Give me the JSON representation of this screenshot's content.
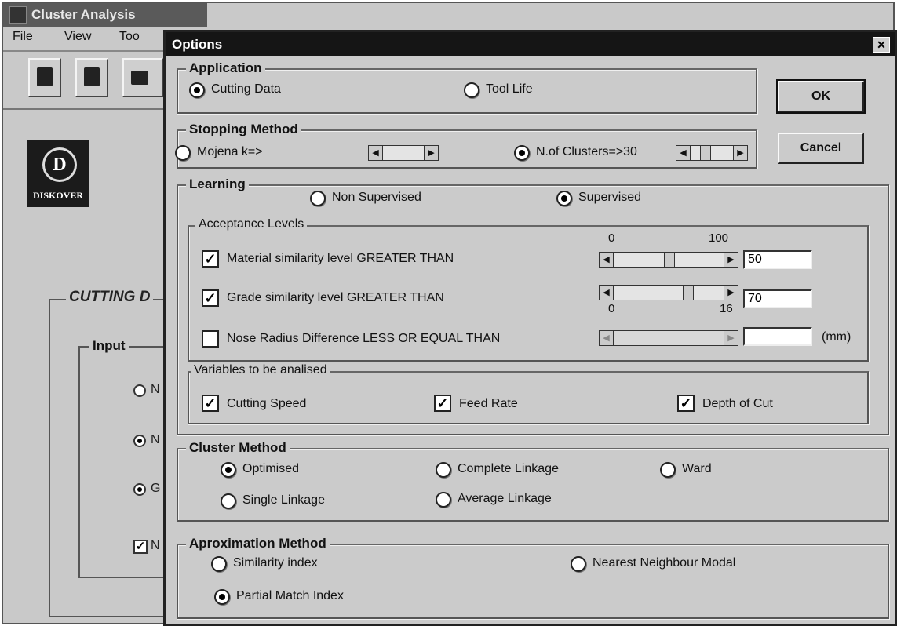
{
  "main": {
    "title": "Cluster Analysis",
    "menu": [
      "File",
      "View",
      "Too"
    ],
    "logo_text": "DISKOVER",
    "logo_letter": "D",
    "cutting_title": "CUTTING D",
    "input_title": "Input",
    "input_rows": [
      {
        "type": "radio",
        "checked": false,
        "label": "N"
      },
      {
        "type": "radio",
        "checked": true,
        "label": "N"
      },
      {
        "type": "radio",
        "checked": true,
        "label": "G"
      },
      {
        "type": "checkbox",
        "checked": true,
        "label": "N"
      }
    ]
  },
  "dialog": {
    "title": "Options",
    "close_glyph": "✕",
    "ok_label": "OK",
    "cancel_label": "Cancel",
    "application": {
      "title": "Application",
      "cutting_data": "Cutting Data",
      "tool_life": "Tool Life",
      "selected": "Cutting Data"
    },
    "stopping": {
      "title": "Stopping Method",
      "mojena": "Mojena k=>",
      "n_clusters": "N.of Clusters=>30",
      "selected": "N.of Clusters=>30"
    },
    "learning": {
      "title": "Learning",
      "non_supervised": "Non Supervised",
      "supervised": "Supervised",
      "selected": "Supervised"
    },
    "acceptance": {
      "title": "Acceptance Levels",
      "scale1_min": "0",
      "scale1_max": "100",
      "scale2_min": "0",
      "scale2_max": "16",
      "material_label": "Material similarity level  GREATER THAN",
      "material_checked": true,
      "material_value": "50",
      "grade_label": "Grade similarity level GREATER THAN",
      "grade_checked": true,
      "grade_value": "70",
      "nose_label": "Nose Radius Difference   LESS OR EQUAL THAN",
      "nose_checked": false,
      "nose_value": "",
      "nose_unit": "(mm)"
    },
    "variables": {
      "title": "Variables to be analised",
      "cutting_speed": "Cutting Speed",
      "feed_rate": "Feed Rate",
      "depth_of_cut": "Depth of Cut",
      "all_checked": true
    },
    "cluster": {
      "title": "Cluster Method",
      "optimised": "Optimised",
      "complete": "Complete Linkage",
      "ward": "Ward",
      "single": "Single Linkage",
      "average": "Average Linkage",
      "selected": "Optimised"
    },
    "approximation": {
      "title": "Aproximation Method",
      "similarity": "Similarity index",
      "nearest": "Nearest Neighbour Modal",
      "partial": "Partial Match Index",
      "selected": "Partial Match Index"
    }
  }
}
